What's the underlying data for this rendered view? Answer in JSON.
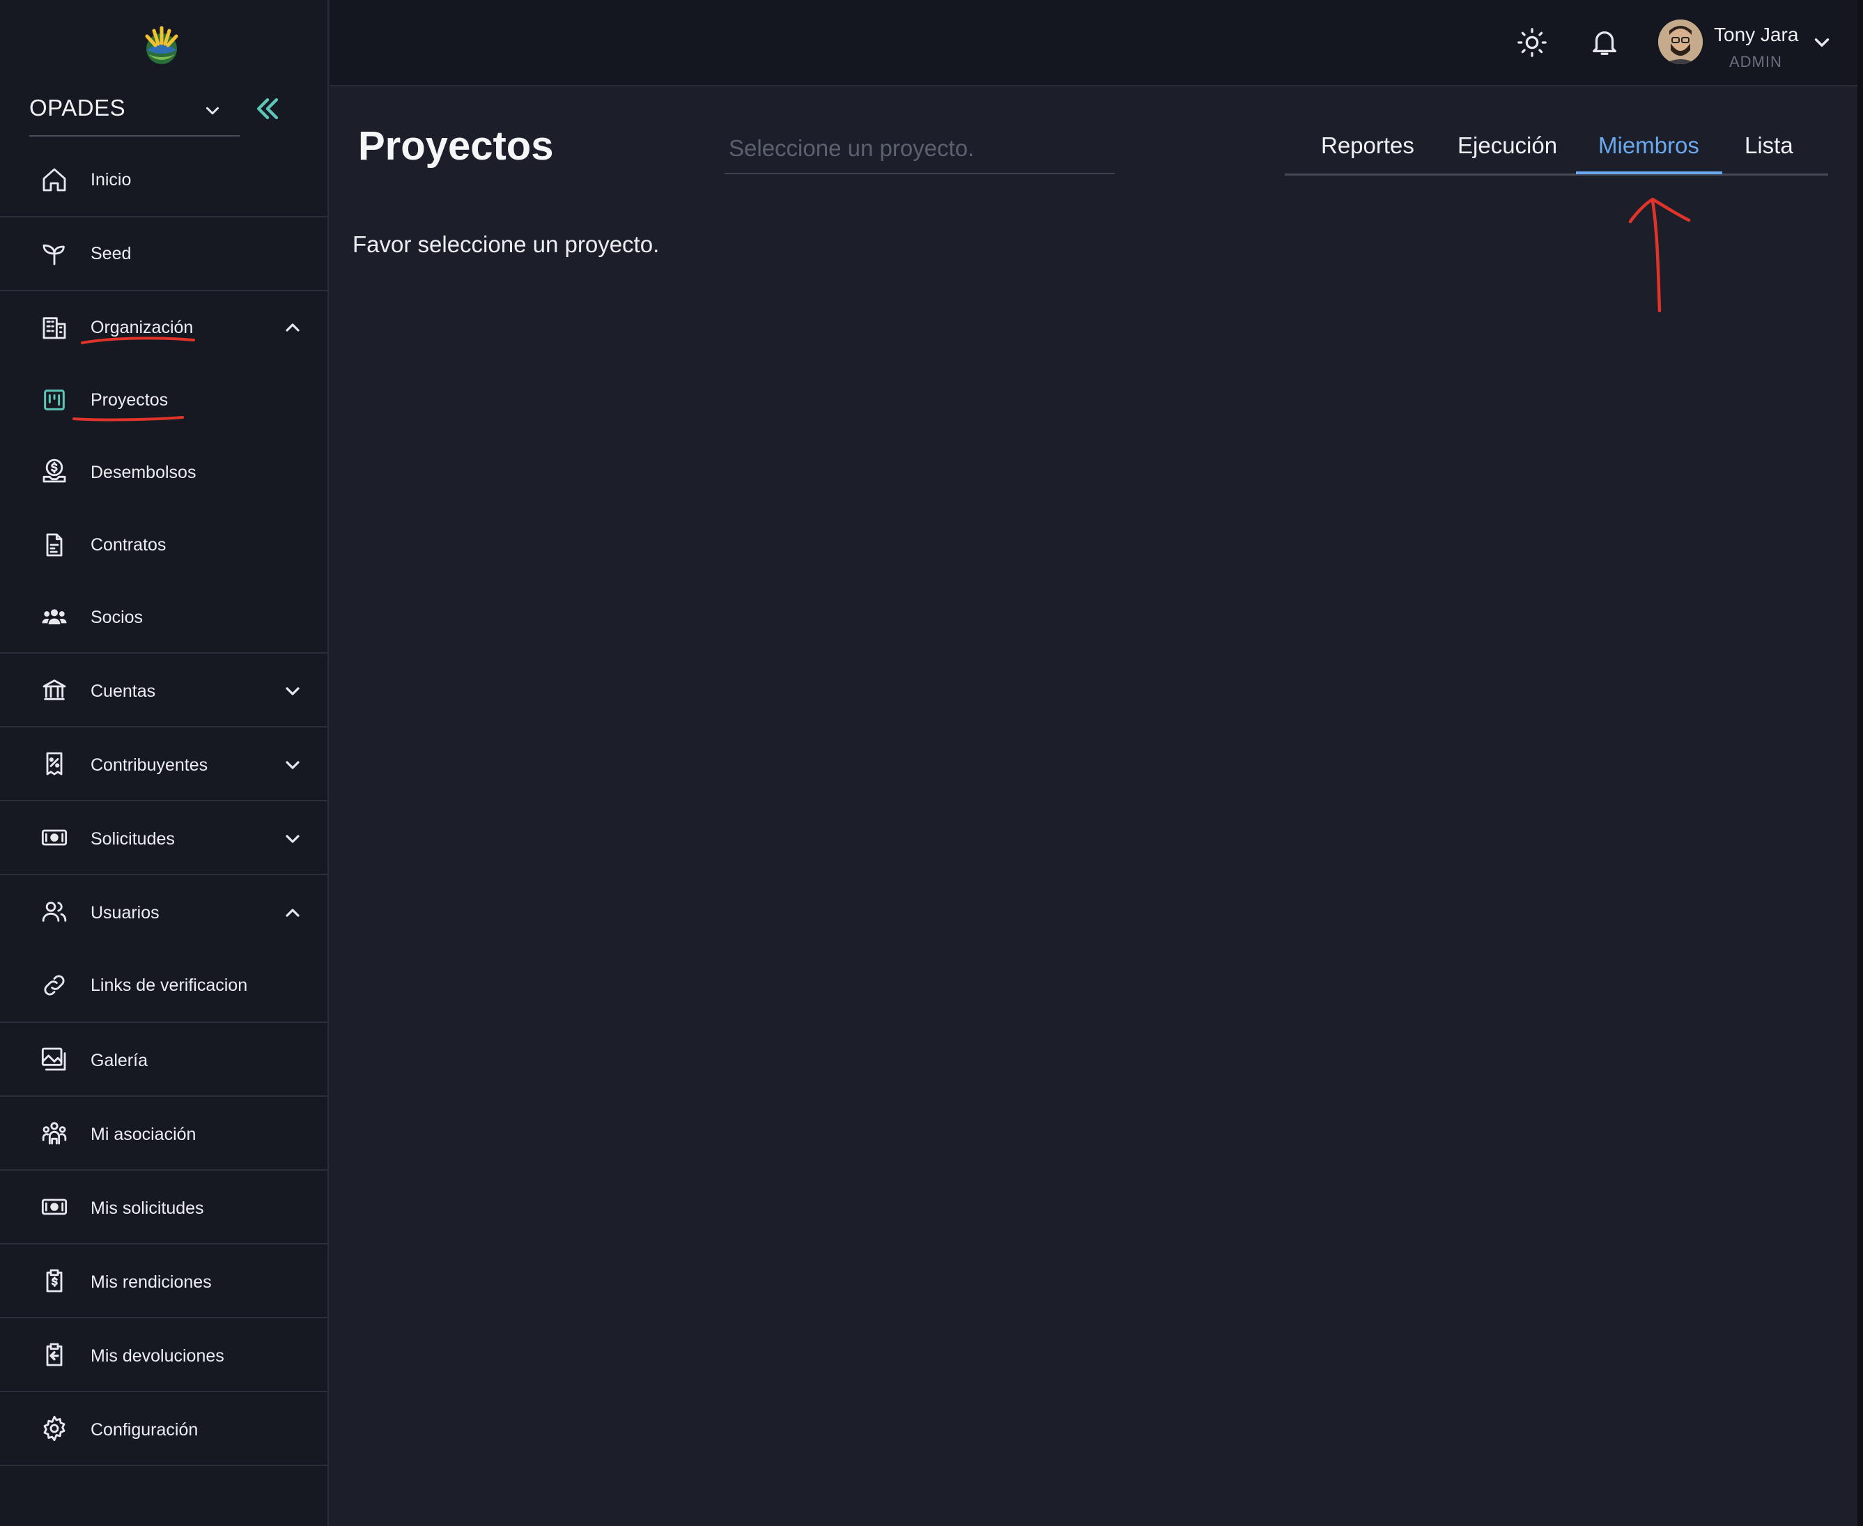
{
  "app": {
    "org_selector": "OPADES"
  },
  "sidebar": {
    "items": [
      {
        "label": "Inicio",
        "icon": "home-icon"
      },
      {
        "label": "Seed",
        "icon": "sprout-icon"
      },
      {
        "label": "Organización",
        "icon": "building-icon",
        "expanded": true
      },
      {
        "label": "Proyectos",
        "icon": "kanban-icon",
        "active": true
      },
      {
        "label": "Desembolsos",
        "icon": "money-hand-icon"
      },
      {
        "label": "Contratos",
        "icon": "contract-icon"
      },
      {
        "label": "Socios",
        "icon": "group-icon"
      },
      {
        "label": "Cuentas",
        "icon": "bank-icon",
        "expanded": false
      },
      {
        "label": "Contribuyentes",
        "icon": "receipt-percent-icon",
        "expanded": false
      },
      {
        "label": "Solicitudes",
        "icon": "cash-icon",
        "expanded": false
      },
      {
        "label": "Usuarios",
        "icon": "users-icon",
        "expanded": true
      },
      {
        "label": "Links de verificacion",
        "icon": "link-icon"
      },
      {
        "label": "Galería",
        "icon": "gallery-icon"
      },
      {
        "label": "Mi asociación",
        "icon": "association-icon"
      },
      {
        "label": "Mis solicitudes",
        "icon": "cash-icon"
      },
      {
        "label": "Mis rendiciones",
        "icon": "clipboard-dollar-icon"
      },
      {
        "label": "Mis devoluciones",
        "icon": "clipboard-return-icon"
      },
      {
        "label": "Configuración",
        "icon": "gear-icon"
      }
    ]
  },
  "header": {
    "user": {
      "name": "Tony Jara",
      "role": "ADMIN"
    }
  },
  "main": {
    "title": "Proyectos",
    "project_select": {
      "placeholder": "Seleccione un proyecto.",
      "value": ""
    },
    "tabs": [
      {
        "label": "Reportes",
        "active": false
      },
      {
        "label": "Ejecución",
        "active": false
      },
      {
        "label": "Miembros",
        "active": true
      },
      {
        "label": "Lista",
        "active": false
      }
    ],
    "empty_message": "Favor seleccione un proyecto."
  },
  "colors": {
    "background": "#1c1f2a",
    "sidebar": "#171922",
    "header": "#141720",
    "accent_tab": "#6aa9f0",
    "accent_teal": "#5ec6b8",
    "annotation_red": "#e0342a"
  }
}
